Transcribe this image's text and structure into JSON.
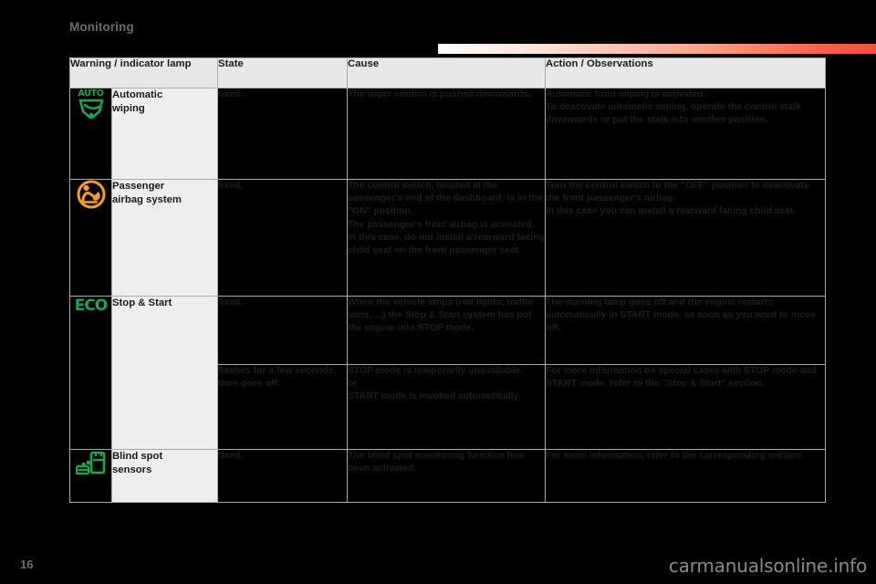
{
  "header": {
    "section_title": "Monitoring",
    "rule_gradient_from": "#ffffff",
    "rule_gradient_to": "#f4513c"
  },
  "table": {
    "columns": [
      {
        "key": "lamp",
        "label": "Warning / indicator lamp"
      },
      {
        "key": "state",
        "label": "State"
      },
      {
        "key": "cause",
        "label": "Cause"
      },
      {
        "key": "action",
        "label": "Action / Observations"
      }
    ],
    "rows": [
      {
        "icon": "auto-wiping-icon",
        "icon_color": "#16a84a",
        "icon_text": "AUTO",
        "lamp": "Automatic\nwiping",
        "lamp_line1": "Automatic",
        "lamp_line2": "wiping",
        "state": "fixed.",
        "cause": "The wiper control is pushed downwards.",
        "action": "Automatic front wiping is activated.\nTo deactivate automatic wiping, operate the control stalk downwards or put the stalk into another position.",
        "action_line1": "Automatic front wiping is activated.",
        "action_line2": "To deactivate automatic wiping, operate the control stalk downwards or put the stalk into another position."
      },
      {
        "icon": "passenger-airbag-icon",
        "icon_color": "#f5a01e",
        "lamp_line1": "Passenger",
        "lamp_line2": "airbag system",
        "state": "fixed.",
        "cause_line1": "The control switch, located at the passenger's end of the dashboard, is in the \"ON\" position.",
        "cause_line2": "The passenger's front airbag is activated. In this case, do not install a rearward facing child seat on the front passenger seat.",
        "action_line1": "Turn the control switch to the \"OFF\" position to deactivate the front passenger's airbag.",
        "action_line2": "In this case you can install a rearward facing child seat."
      },
      {
        "icon": "eco-icon",
        "icon_color": "#16a84a",
        "icon_text": "ECO",
        "lamp_line1": "Stop & Start",
        "lamp_line2": "",
        "state": "fixed.",
        "cause_line1": "When the vehicle stops (red lights, traffic jams, ...) the Stop & Start system has put the engine into STOP mode.",
        "action_line1": "The warning lamp goes off and the engine restarts automatically in START mode, as soon as you want to move off."
      },
      {
        "icon": "",
        "lamp_line1": "",
        "state": "flashes for a few seconds, then goes off.",
        "cause_line1": "STOP mode is temporarily unavailable.",
        "cause_line2": "or",
        "cause_line3": "START mode is invoked automatically.",
        "action_line1": "For more information on special cases with STOP mode and START mode, refer to the \"Stop & Start\" section."
      },
      {
        "icon": "blind-spot-sensors-icon",
        "icon_color": "#16a84a",
        "lamp_line1": "Blind spot",
        "lamp_line2": "sensors",
        "state": "fixed.",
        "cause_line1": "The blind spot monitoring function has been activated.",
        "action_line1": "For more information, refer to the corresponding section."
      }
    ]
  },
  "footer": {
    "page_number": "16",
    "watermark": "carmanualsonline.info"
  }
}
